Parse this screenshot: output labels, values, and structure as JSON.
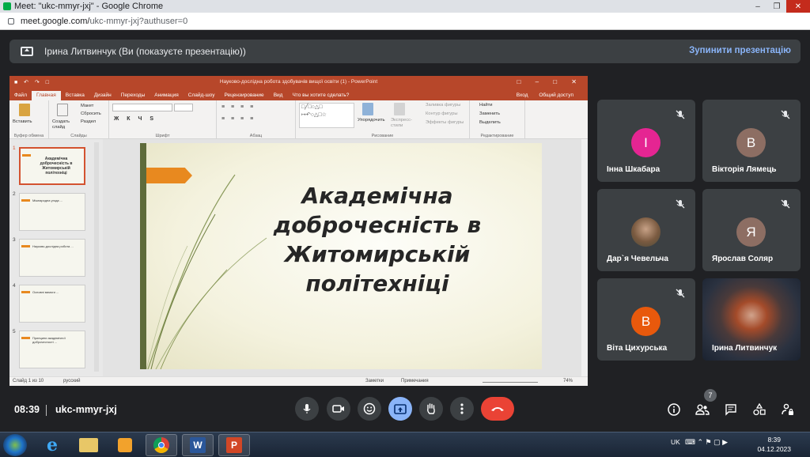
{
  "browser": {
    "window_title": "Meet: \"ukc-mmyr-jxj\" - Google Chrome",
    "url_main": "meet.google.com/",
    "url_rest": "ukc-mmyr-jxj?authuser=0"
  },
  "banner": {
    "text": "Ірина Литвинчук (Ви (показуєте презентацію))",
    "stop_label": "Зупинити презентацію"
  },
  "powerpoint": {
    "title": "Науково-дослідна робота здобувачів вищої освіти (1) - PowerPoint",
    "tabs": [
      "Файл",
      "Главная",
      "Вставка",
      "Дизайн",
      "Переходы",
      "Анимация",
      "Слайд-шоу",
      "Рецензирование",
      "Вид",
      "Что вы хотите сделать?"
    ],
    "tabs_right": [
      "Вход",
      "Общий доступ"
    ],
    "ribbon": {
      "paste": "Вставить",
      "create_slide": "Создать слайд",
      "layout": "Макет",
      "reset": "Сбросить",
      "section": "Раздел",
      "arrange": "Упорядочить",
      "quick_styles": "Экспресс-стили",
      "fill": "Заливка фигуры",
      "outline": "Контур фигуры",
      "effects": "Эффекты фигуры",
      "find": "Найти",
      "replace": "Заменить",
      "select": "Выделить",
      "groups": [
        "Буфер обмена",
        "Слайды",
        "Шрифт",
        "Абзац",
        "Рисование",
        "Редактирование"
      ]
    },
    "thumbnails": [
      {
        "num": "1",
        "text": "Академічна доброчесність в Житомирській політехніці"
      },
      {
        "num": "2",
        "text": "Міжнародна угода ... "
      },
      {
        "num": "3",
        "text": "Науково-дослідна робота ..."
      },
      {
        "num": "4",
        "text": "Основні вимоги ..."
      },
      {
        "num": "5",
        "text": "Принципи академічної доброчесності ..."
      }
    ],
    "slide_heading": "Академічна доброчесність в Житомирській політехніці",
    "status": {
      "slide": "Слайд 1 из 10",
      "lang": "русский",
      "notes": "Заметки",
      "comments": "Примечания",
      "zoom": "74%"
    }
  },
  "participants": [
    {
      "name": "Інна Шкабара",
      "initial": "І",
      "color": "#e52592",
      "type": "initial"
    },
    {
      "name": "Вікторія Лямець",
      "initial": "В",
      "color": "#8d6e63",
      "type": "initial"
    },
    {
      "name": "Дар`я Чевельча",
      "initial": "",
      "color": "",
      "type": "photo"
    },
    {
      "name": "Ярослав Соляр",
      "initial": "Я",
      "color": "#8d6e63",
      "type": "initial"
    },
    {
      "name": "Віта Цихурська",
      "initial": "В",
      "color": "#e8590c",
      "type": "initial"
    },
    {
      "name": "Ірина Литвинчук",
      "initial": "",
      "color": "",
      "type": "video"
    }
  ],
  "bottom": {
    "time": "08:39",
    "meeting_code": "ukc-mmyr-jxj",
    "people_count": "7"
  },
  "taskbar": {
    "lang": "UK",
    "time": "8:39",
    "date": "04.12.2023"
  }
}
